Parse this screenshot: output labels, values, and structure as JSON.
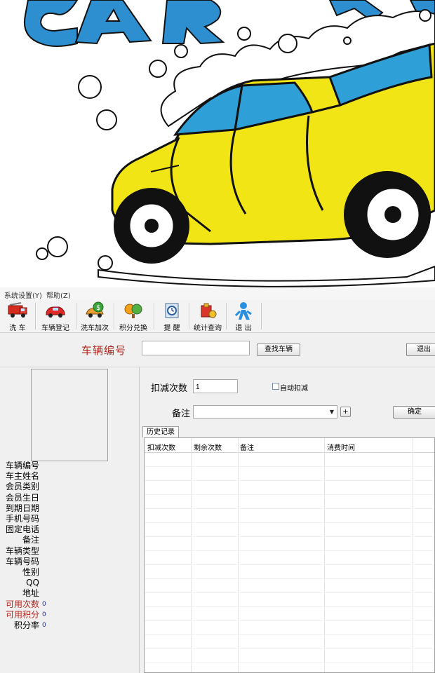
{
  "banner": {
    "alt_icon": "car-wash-illustration",
    "colors": {
      "car": "#f2e515",
      "window": "#2f9fd8",
      "outline": "#111111",
      "text": "#2e8fd0"
    }
  },
  "menu": {
    "items": [
      "系统设置(Y)",
      "帮助(Z)"
    ]
  },
  "toolbar": {
    "buttons": [
      {
        "label": "洗 车",
        "icon": "fire-truck-icon"
      },
      {
        "label": "车辆登记",
        "icon": "red-car-icon"
      },
      {
        "label": "洗车加次",
        "icon": "money-car-icon"
      },
      {
        "label": "积分兑换",
        "icon": "coins-icon"
      },
      {
        "label": "提 醒",
        "icon": "reminder-icon"
      },
      {
        "label": "统计查询",
        "icon": "statistics-icon"
      },
      {
        "label": "退 出",
        "icon": "exit-person-icon"
      }
    ]
  },
  "search": {
    "label": "车辆编号",
    "value": "",
    "find_label": "查找车辆",
    "exit_label": "退出"
  },
  "info": {
    "fields": [
      {
        "key": "车辆编号",
        "value": "",
        "red": false
      },
      {
        "key": "车主姓名",
        "value": "",
        "red": false
      },
      {
        "key": "会员类别",
        "value": "",
        "red": false
      },
      {
        "key": "会员生日",
        "value": "",
        "red": false
      },
      {
        "key": "到期日期",
        "value": "",
        "red": false
      },
      {
        "key": "手机号码",
        "value": "",
        "red": false
      },
      {
        "key": "固定电话",
        "value": "",
        "red": false
      },
      {
        "key": "备注",
        "value": "",
        "red": false
      },
      {
        "key": "车辆类型",
        "value": "",
        "red": false
      },
      {
        "key": "车辆号码",
        "value": "",
        "red": false
      },
      {
        "key": "性别",
        "value": "",
        "red": false
      },
      {
        "key": "QQ",
        "value": "",
        "red": false
      },
      {
        "key": "地址",
        "value": "",
        "red": false
      },
      {
        "key": "可用次数",
        "value": "0",
        "red": true
      },
      {
        "key": "可用积分",
        "value": "0",
        "red": true
      },
      {
        "key": "积分率",
        "value": "0",
        "red": false
      }
    ]
  },
  "deduct": {
    "label": "扣减次数",
    "value": "1",
    "auto_label": "自动扣减",
    "auto_checked": false
  },
  "remark": {
    "label": "备注",
    "value": "",
    "add_label": "+",
    "ok_label": "确定"
  },
  "history": {
    "tab_label": "历史记录",
    "columns": [
      "扣减次数",
      "剩余次数",
      "备注",
      "消费时间"
    ],
    "rows": []
  }
}
